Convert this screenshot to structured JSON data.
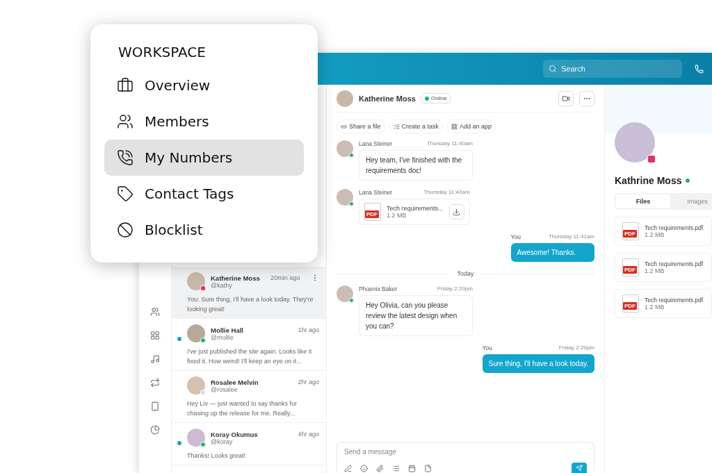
{
  "menu": {
    "heading": "WORKSPACE",
    "items": [
      {
        "label": "Overview",
        "selected": false
      },
      {
        "label": "Members",
        "selected": false
      },
      {
        "label": "My Numbers",
        "selected": true
      },
      {
        "label": "Contact Tags",
        "selected": false
      },
      {
        "label": "Blocklist",
        "selected": false
      }
    ]
  },
  "topbar": {
    "search": {
      "placeholder": "Search"
    }
  },
  "conversations": [
    {
      "name": "Katherine Moss",
      "handle": "@kathy",
      "time": "20min ago",
      "preview": "You: Sure thing, I'll have a look today. They're looking great!",
      "unread": false,
      "selected": true,
      "kind": "instagram"
    },
    {
      "name": "Mollie Hall",
      "handle": "@mollie",
      "time": "1hr ago",
      "preview": "I've just published the site again. Looks like it fixed it. How weird! I'll keep an eye on it...",
      "unread": true,
      "selected": false,
      "kind": "contact",
      "online": true
    },
    {
      "name": "Rosalee Melvin",
      "handle": "@rosalee",
      "time": "2hr ago",
      "preview": "Hey Liv — just wanted to say thanks for chasing up the release for me. Really...",
      "unread": false,
      "selected": false,
      "kind": "contact",
      "online": false
    },
    {
      "name": "Koray Okumus",
      "handle": "@koray",
      "time": "4hr ago",
      "preview": "Thanks! Looks great!",
      "unread": true,
      "selected": false,
      "kind": "contact",
      "online": true
    }
  ],
  "chat": {
    "name": "Katherine Moss",
    "presence": "Online",
    "actions": [
      "Share a file",
      "Create a task",
      "Add an app"
    ],
    "messages": [
      {
        "kind": "text",
        "sender": "Lana Steiner",
        "time": "Thursday 11:40am",
        "text": "Hey team, I've finished with the requirements doc!",
        "mine": false
      },
      {
        "kind": "file",
        "sender": "Lana Steiner",
        "time": "Thursday 11:40am",
        "file": "Tech requirements...",
        "size": "1.2 MB",
        "type": "PDF",
        "mine": false
      },
      {
        "kind": "text",
        "sender": "You",
        "time": "Thursday 11:41am",
        "text": "Awesome! Thanks.",
        "mine": true
      },
      {
        "kind": "divider",
        "text": "Today"
      },
      {
        "kind": "text",
        "sender": "Phoenix Baker",
        "time": "Friday 2:20pm",
        "text": "Hey Olivia, can you please review the latest design when you can?",
        "mine": false
      },
      {
        "kind": "text",
        "sender": "You",
        "time": "Friday 2:20pm",
        "text": "Sure thing, I'll have a look today.",
        "mine": true
      }
    ],
    "composer": {
      "placeholder": "Send a message"
    }
  },
  "profile": {
    "name": "Kathrine Moss",
    "online": true,
    "tabs": [
      {
        "label": "Files",
        "selected": true
      },
      {
        "label": "Images",
        "selected": false
      }
    ],
    "files": [
      {
        "name": "Tech requirements.pdf",
        "size": "1.2 MB",
        "type": "PDF"
      },
      {
        "name": "Tech requirements.pdf",
        "size": "1.2 MB",
        "type": "PDF"
      },
      {
        "name": "Tech requirements.pdf",
        "size": "1.2 MB",
        "type": "PDF"
      }
    ]
  }
}
